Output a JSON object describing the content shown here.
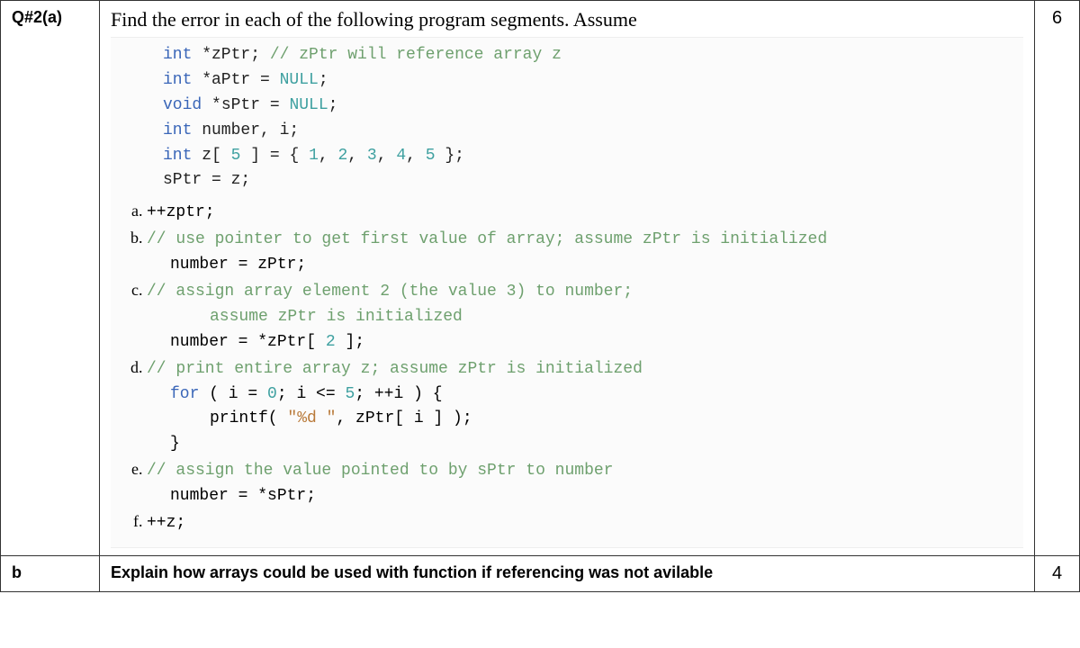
{
  "rows": {
    "a": {
      "label": "Q#2(a)",
      "marks": "6",
      "prompt": "Find the error in each of the following program segments. Assume",
      "decl": {
        "l1_a": "int",
        "l1_b": " *zPtr;",
        "l1_c": " // zPtr will reference array z",
        "l2_a": "int",
        "l2_b": " *aPtr = ",
        "l2_c": "NULL",
        "l2_d": ";",
        "l3_a": "void",
        "l3_b": " *sPtr = ",
        "l3_c": "NULL",
        "l3_d": ";",
        "l4_a": "int",
        "l4_b": " number, i;",
        "l5_a": "int",
        "l5_b": " z[ ",
        "l5_c": "5",
        "l5_d": " ] = { ",
        "l5_e": "1",
        "l5_f": ", ",
        "l5_g": "2",
        "l5_h": ", ",
        "l5_i": "3",
        "l5_j": ", ",
        "l5_k": "4",
        "l5_l": ", ",
        "l5_m": "5",
        "l5_n": " };",
        "l6": "sPtr = z;"
      },
      "parts": {
        "pa": {
          "code": "++zptr;"
        },
        "pb": {
          "c1": "// use pointer to get first value of array; assume zPtr is initialized",
          "c2": "number = zPtr;"
        },
        "pc": {
          "c1": "// assign array element 2 (the value 3) to number;",
          "c2": "assume zPtr is initialized",
          "c3a": "number = *zPtr[ ",
          "c3b": "2",
          "c3c": " ];"
        },
        "pd": {
          "c1": "// print entire array z; assume zPtr is initialized",
          "c2a": "for",
          "c2b": " ( i = ",
          "c2c": "0",
          "c2d": "; i <= ",
          "c2e": "5",
          "c2f": "; ++i ) {",
          "c3a": "printf( ",
          "c3b": "\"%d \"",
          "c3c": ", zPtr[ i ] );",
          "c4": "}"
        },
        "pe": {
          "c1": "// assign the value pointed to by sPtr to number",
          "c2": "number = *sPtr;"
        },
        "pf": {
          "code": "++z;"
        }
      }
    },
    "b": {
      "label": "b",
      "marks": "4",
      "text": "Explain how arrays could be used with function if  referencing was not avilable"
    }
  }
}
